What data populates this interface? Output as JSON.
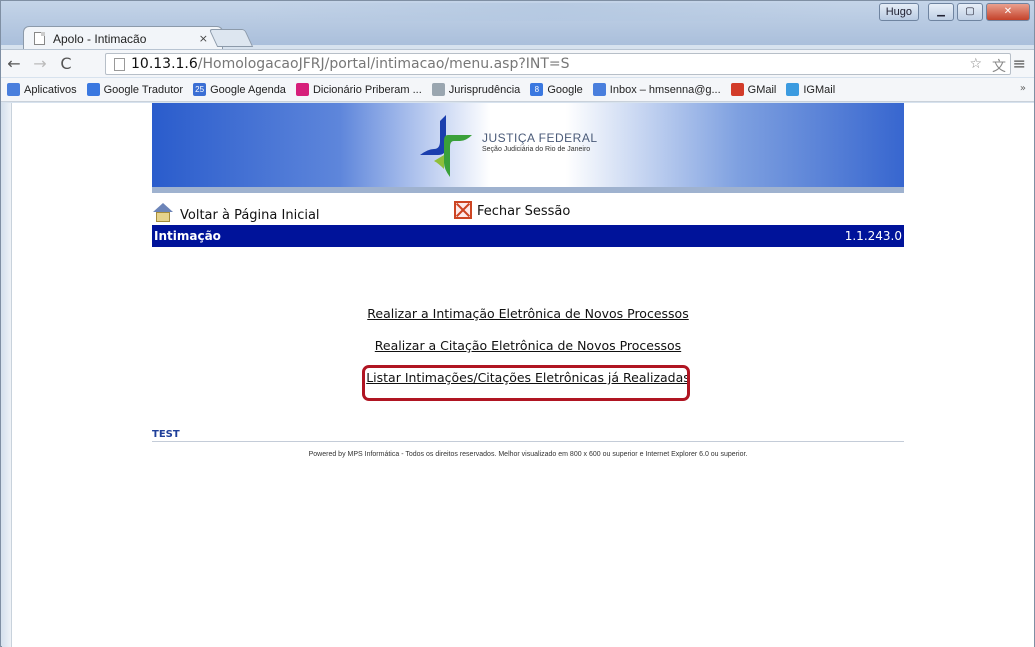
{
  "browser": {
    "tab_title": "Apolo - Intimacão",
    "tab_close": "×",
    "user_badge": "Hugo",
    "url_host": "10.13.1.6",
    "url_path": "/HomologacaoJFRJ/portal/intimacao/menu.asp?INT=S",
    "bookmarks": [
      {
        "label": "Aplicativos",
        "icon": "apps-grid-icon",
        "color": "#4a7fdd"
      },
      {
        "label": "Google Tradutor",
        "icon": "translate-icon",
        "color": "#3a78e0"
      },
      {
        "label": "Google Agenda",
        "icon": "calendar-icon",
        "color": "#3b6fd4",
        "badge": "25"
      },
      {
        "label": "Dicionário Priberam ...",
        "icon": "dictionary-icon",
        "color": "#d61f7a"
      },
      {
        "label": "Jurisprudência",
        "icon": "jurisprudence-icon",
        "color": "#9aa6b0"
      },
      {
        "label": "Google",
        "icon": "google-plus-icon",
        "color": "#3a78e0",
        "badge": "8"
      },
      {
        "label": "Inbox – hmsenna@g...",
        "icon": "inbox-icon",
        "color": "#4a7fdd"
      },
      {
        "label": "GMail",
        "icon": "gmail-icon",
        "color": "#d23c2a"
      },
      {
        "label": "IGMail",
        "icon": "igmail-icon",
        "color": "#3b9be0"
      }
    ],
    "bookmarks_more": "»"
  },
  "page": {
    "logo_title": "JUSTIÇA FEDERAL",
    "logo_subtitle": "Seção Judiciária do Rio de Janeiro",
    "home_link": "Voltar à Página Inicial",
    "close_session": "Fechar Sessão",
    "section_title": "Intimação",
    "version": "1.1.243.0",
    "menu": [
      "Realizar a Intimação Eletrônica de Novos Processos",
      "Realizar a Citação Eletrônica de Novos Processos",
      "Listar Intimações/Citações Eletrônicas já Realizadas"
    ],
    "environment": "TEST",
    "footer": "Powered by MPS Informática - Todos os direitos reservados. Melhor visualizado em 800 x 600 ou superior e Internet Explorer 6.0 ou superior."
  },
  "colors": {
    "section_bar": "#00139a",
    "highlight": "#b01522"
  }
}
